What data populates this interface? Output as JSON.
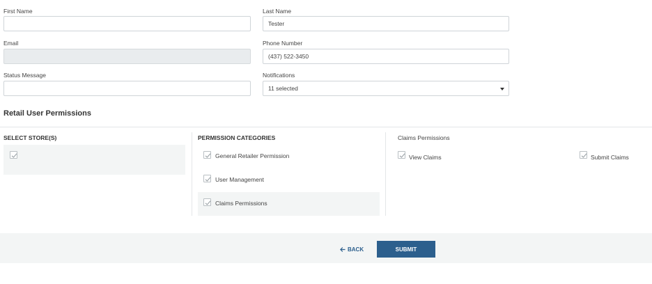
{
  "form": {
    "first_name": {
      "label": "First Name",
      "value": ""
    },
    "last_name": {
      "label": "Last Name",
      "value": "Tester"
    },
    "email": {
      "label": "Email",
      "value": ""
    },
    "phone": {
      "label": "Phone Number",
      "value": "(437) 522-3450"
    },
    "status": {
      "label": "Status Message",
      "value": ""
    },
    "notifications": {
      "label": "Notifications",
      "value": "11 selected"
    }
  },
  "permissions": {
    "title": "Retail User Permissions",
    "stores": {
      "heading": "SELECT STORE(S)"
    },
    "categories": {
      "heading": "PERMISSION CATEGORIES",
      "items": [
        {
          "label": "General Retailer Permission",
          "checked": true
        },
        {
          "label": "User Management",
          "checked": true
        },
        {
          "label": "Claims Permissions",
          "checked": true
        }
      ]
    },
    "claims": {
      "heading": "Claims Permissions",
      "items": [
        {
          "label": "View Claims",
          "checked": true
        },
        {
          "label": "Submit Claims",
          "checked": true
        }
      ]
    }
  },
  "footer": {
    "back_label": "BACK",
    "submit_label": "SUBMIT"
  },
  "icons": {
    "back": "arrow-left-icon",
    "checkmark": "checkmark-icon",
    "caret": "chevron-down-icon"
  },
  "colors": {
    "primary": "#2c5f8d",
    "footer_bg": "#f3f5f5",
    "disabled_bg": "#e9ecee"
  }
}
